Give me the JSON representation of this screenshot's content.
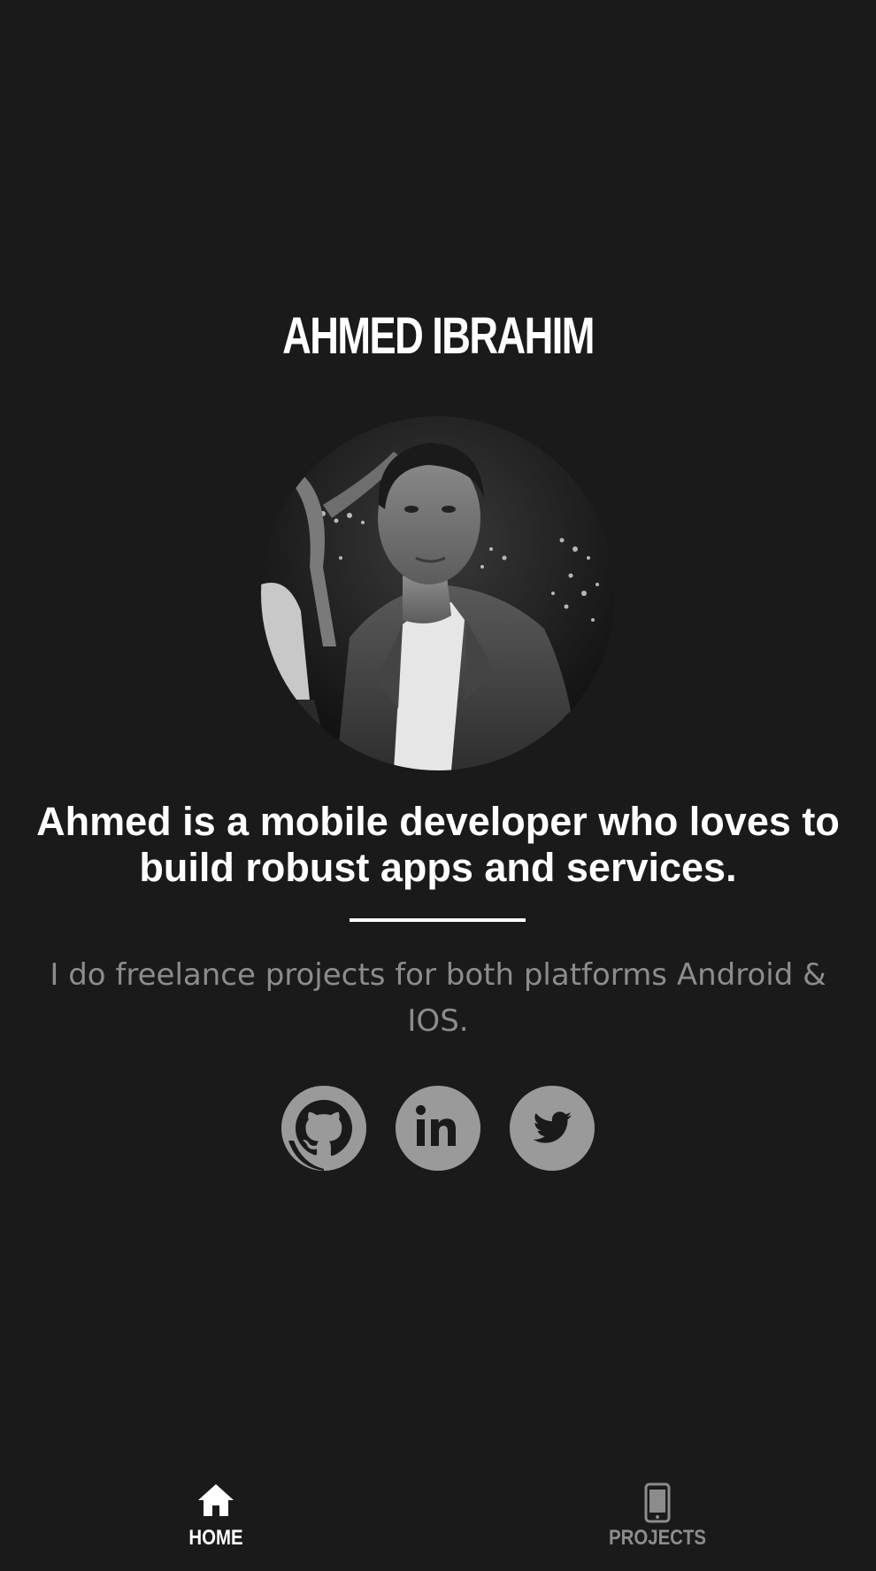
{
  "profile": {
    "name": "AHMED IBRAHIM",
    "headline": "Ahmed is a mobile developer who loves to build robust apps and services.",
    "subtext": "I do freelance projects for both platforms Android & IOS."
  },
  "socials": [
    {
      "icon": "github-icon"
    },
    {
      "icon": "linkedin-icon",
      "glyph": "in"
    },
    {
      "icon": "twitter-icon"
    }
  ],
  "nav": {
    "home_label": "HOME",
    "projects_label": "PROJECTS",
    "active": "home"
  },
  "colors": {
    "background": "#1a1a1a",
    "text": "#ffffff",
    "muted": "#8c8c8c",
    "icon_bg": "#9a9a9a"
  }
}
